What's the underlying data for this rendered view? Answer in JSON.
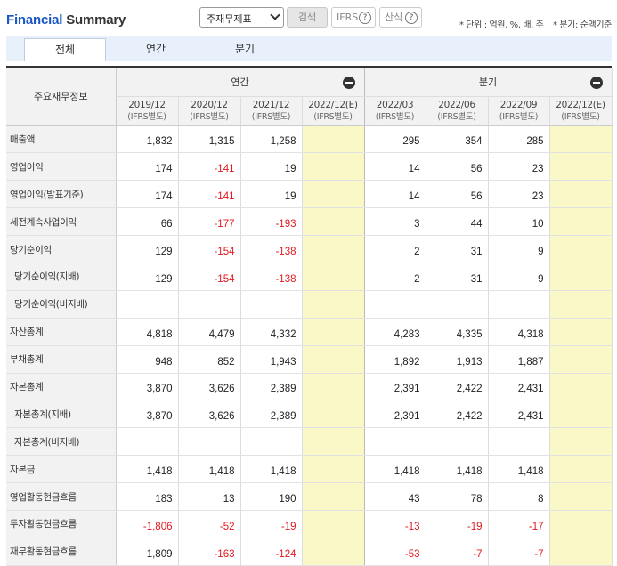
{
  "header": {
    "title_part1": "Financial",
    "title_part2": "Summary",
    "select_value": "주재무제표",
    "search_label": "검색",
    "ifrs_label": "IFRS",
    "calc_label": "산식",
    "help_glyph": "?",
    "unit_note": "* 단위 : 억원, %, 배, 주",
    "period_note": "* 분기: 순액기준"
  },
  "tabs": [
    {
      "label": "전체",
      "active": true
    },
    {
      "label": "연간",
      "active": false
    },
    {
      "label": "분기",
      "active": false
    }
  ],
  "table": {
    "row_header_title": "주요재무정보",
    "group_annual": "연간",
    "group_quarter": "분기",
    "columns": [
      {
        "period": "2019/12",
        "basis": "(IFRS별도)"
      },
      {
        "period": "2020/12",
        "basis": "(IFRS별도)"
      },
      {
        "period": "2021/12",
        "basis": "(IFRS별도)"
      },
      {
        "period": "2022/12(E)",
        "basis": "(IFRS별도)"
      },
      {
        "period": "2022/03",
        "basis": "(IFRS별도)"
      },
      {
        "period": "2022/06",
        "basis": "(IFRS별도)"
      },
      {
        "period": "2022/09",
        "basis": "(IFRS별도)"
      },
      {
        "period": "2022/12(E)",
        "basis": "(IFRS별도)"
      }
    ],
    "rows": [
      {
        "label": "매출액",
        "indent": false,
        "values": [
          "1,832",
          "1,315",
          "1,258",
          "",
          "295",
          "354",
          "285",
          ""
        ]
      },
      {
        "label": "영업이익",
        "indent": false,
        "values": [
          "174",
          "-141",
          "19",
          "",
          "14",
          "56",
          "23",
          ""
        ]
      },
      {
        "label": "영업이익(발표기준)",
        "indent": false,
        "values": [
          "174",
          "-141",
          "19",
          "",
          "14",
          "56",
          "23",
          ""
        ]
      },
      {
        "label": "세전계속사업이익",
        "indent": false,
        "values": [
          "66",
          "-177",
          "-193",
          "",
          "3",
          "44",
          "10",
          ""
        ]
      },
      {
        "label": "당기순이익",
        "indent": false,
        "values": [
          "129",
          "-154",
          "-138",
          "",
          "2",
          "31",
          "9",
          ""
        ]
      },
      {
        "label": "당기순이익(지배)",
        "indent": true,
        "values": [
          "129",
          "-154",
          "-138",
          "",
          "2",
          "31",
          "9",
          ""
        ]
      },
      {
        "label": "당기순이익(비지배)",
        "indent": true,
        "values": [
          "",
          "",
          "",
          "",
          "",
          "",
          "",
          ""
        ]
      },
      {
        "label": "자산총계",
        "indent": false,
        "values": [
          "4,818",
          "4,479",
          "4,332",
          "",
          "4,283",
          "4,335",
          "4,318",
          ""
        ]
      },
      {
        "label": "부채총계",
        "indent": false,
        "values": [
          "948",
          "852",
          "1,943",
          "",
          "1,892",
          "1,913",
          "1,887",
          ""
        ]
      },
      {
        "label": "자본총계",
        "indent": false,
        "values": [
          "3,870",
          "3,626",
          "2,389",
          "",
          "2,391",
          "2,422",
          "2,431",
          ""
        ]
      },
      {
        "label": "자본총계(지배)",
        "indent": true,
        "values": [
          "3,870",
          "3,626",
          "2,389",
          "",
          "2,391",
          "2,422",
          "2,431",
          ""
        ]
      },
      {
        "label": "자본총계(비지배)",
        "indent": true,
        "values": [
          "",
          "",
          "",
          "",
          "",
          "",
          "",
          ""
        ]
      },
      {
        "label": "자본금",
        "indent": false,
        "values": [
          "1,418",
          "1,418",
          "1,418",
          "",
          "1,418",
          "1,418",
          "1,418",
          ""
        ]
      },
      {
        "label": "영업활동현금흐름",
        "indent": false,
        "values": [
          "183",
          "13",
          "190",
          "",
          "43",
          "78",
          "8",
          ""
        ]
      },
      {
        "label": "투자활동현금흐름",
        "indent": false,
        "values": [
          "-1,806",
          "-52",
          "-19",
          "",
          "-13",
          "-19",
          "-17",
          ""
        ]
      },
      {
        "label": "재무활동현금흐름",
        "indent": false,
        "values": [
          "1,809",
          "-163",
          "-124",
          "",
          "-53",
          "-7",
          "-7",
          ""
        ]
      }
    ]
  },
  "colors": {
    "brand_blue": "#1a56c7",
    "negative_red": "#e0191f",
    "estimate_bg": "#fbf8c8",
    "tab_bar_bg": "#e8f1fb"
  }
}
